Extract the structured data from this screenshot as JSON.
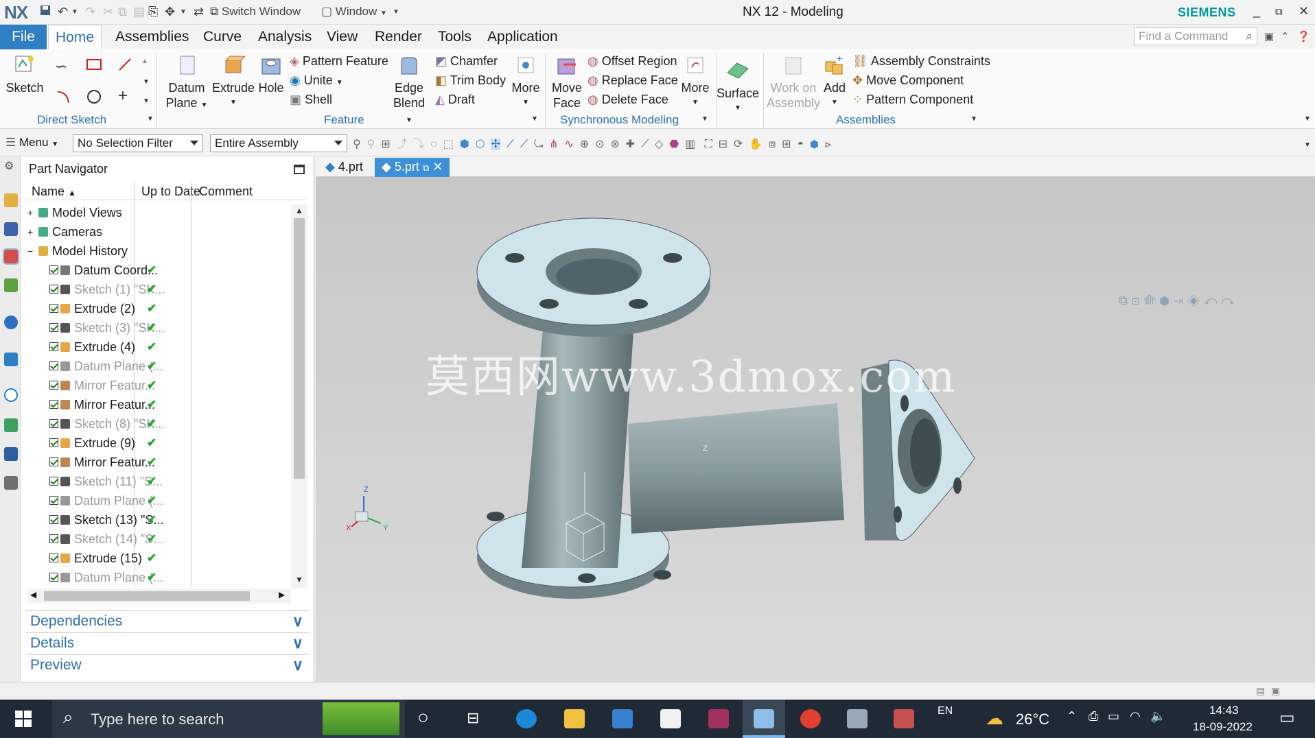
{
  "titlebar": {
    "app_logo": "NX",
    "switch_window": "Switch Window",
    "window_menu": "Window",
    "title": "NX 12 - Modeling",
    "brand": "SIEMENS"
  },
  "menu": {
    "file": "File",
    "tabs": [
      "Home",
      "Assemblies",
      "Curve",
      "Analysis",
      "View",
      "Render",
      "Tools",
      "Application"
    ],
    "active_tab": "Home",
    "find_placeholder": "Find a Command"
  },
  "ribbon": {
    "direct_sketch": {
      "sketch": "Sketch",
      "label": "Direct Sketch"
    },
    "feature": {
      "datum_plane": "Datum Plane",
      "datum_plane_l1": "Datum",
      "datum_plane_l2": "Plane",
      "extrude": "Extrude",
      "hole": "Hole",
      "pattern_feature": "Pattern Feature",
      "unite": "Unite",
      "shell": "Shell",
      "edge_blend_l1": "Edge",
      "edge_blend_l2": "Blend",
      "chamfer": "Chamfer",
      "trim_body": "Trim Body",
      "draft": "Draft",
      "more": "More",
      "label": "Feature"
    },
    "sync": {
      "move_face_l1": "Move",
      "move_face_l2": "Face",
      "offset_region": "Offset Region",
      "replace_face": "Replace Face",
      "delete_face": "Delete Face",
      "more": "More",
      "label": "Synchronous Modeling"
    },
    "surface": {
      "surface": "Surface"
    },
    "assemblies": {
      "work_on_l1": "Work on",
      "work_on_l2": "Assembly",
      "add": "Add",
      "assembly_constraints": "Assembly Constraints",
      "move_component": "Move Component",
      "pattern_component": "Pattern Component",
      "label": "Assemblies"
    }
  },
  "selbar": {
    "menu": "Menu",
    "filter": "No Selection Filter",
    "scope": "Entire Assembly"
  },
  "navigator": {
    "title": "Part Navigator",
    "columns": [
      "Name",
      "Up to Date",
      "Comment"
    ],
    "rows": [
      {
        "name": "Model Views",
        "level": 0,
        "type": "group",
        "dim": false,
        "uptodate": ""
      },
      {
        "name": "Cameras",
        "level": 0,
        "type": "group",
        "dim": false,
        "uptodate": ""
      },
      {
        "name": "Model History",
        "level": 0,
        "type": "folder",
        "dim": false,
        "uptodate": ""
      },
      {
        "name": "Datum Coord...",
        "level": 1,
        "type": "datum",
        "dim": false,
        "uptodate": "✔"
      },
      {
        "name": "Sketch (1) \"SK...",
        "level": 1,
        "type": "sketch",
        "dim": true,
        "uptodate": "✔"
      },
      {
        "name": "Extrude (2)",
        "level": 1,
        "type": "extrude",
        "dim": false,
        "uptodate": "✔"
      },
      {
        "name": "Sketch (3) \"SK...",
        "level": 1,
        "type": "sketch",
        "dim": true,
        "uptodate": "✔"
      },
      {
        "name": "Extrude (4)",
        "level": 1,
        "type": "extrude",
        "dim": false,
        "uptodate": "✔"
      },
      {
        "name": "Datum Plane (...",
        "level": 1,
        "type": "plane",
        "dim": true,
        "uptodate": "✔"
      },
      {
        "name": "Mirror Featur...",
        "level": 1,
        "type": "mirror",
        "dim": true,
        "uptodate": "✔"
      },
      {
        "name": "Mirror Featur...",
        "level": 1,
        "type": "mirror",
        "dim": false,
        "uptodate": "✔"
      },
      {
        "name": "Sketch (8) \"SK...",
        "level": 1,
        "type": "sketch",
        "dim": true,
        "uptodate": "✔"
      },
      {
        "name": "Extrude (9)",
        "level": 1,
        "type": "extrude",
        "dim": false,
        "uptodate": "✔"
      },
      {
        "name": "Mirror Featur...",
        "level": 1,
        "type": "mirror",
        "dim": false,
        "uptodate": "✔"
      },
      {
        "name": "Sketch (11) \"S...",
        "level": 1,
        "type": "sketch",
        "dim": true,
        "uptodate": "✔"
      },
      {
        "name": "Datum Plane (...",
        "level": 1,
        "type": "plane",
        "dim": true,
        "uptodate": "✔"
      },
      {
        "name": "Sketch (13) \"S...",
        "level": 1,
        "type": "sketch",
        "dim": false,
        "uptodate": "✔"
      },
      {
        "name": "Sketch (14) \"S...",
        "level": 1,
        "type": "sketch",
        "dim": true,
        "uptodate": "✔"
      },
      {
        "name": "Extrude (15)",
        "level": 1,
        "type": "extrude",
        "dim": false,
        "uptodate": "✔"
      },
      {
        "name": "Datum Plane (...",
        "level": 1,
        "type": "plane",
        "dim": true,
        "uptodate": "✔"
      }
    ],
    "panels": [
      "Dependencies",
      "Details",
      "Preview"
    ]
  },
  "doc_tabs": [
    "4.prt",
    "5.prt"
  ],
  "active_doc": "5.prt",
  "watermark": "莫西网www.3dmox.com",
  "triad": {
    "z": "Z",
    "x": "X",
    "y": "Y"
  },
  "taskbar": {
    "search_placeholder": "Type here to search",
    "lang": "EN",
    "weather": "26°C",
    "time": "14:43",
    "date": "18-09-2022"
  },
  "colors": {
    "accent": "#2f7fc4",
    "brand": "#009999",
    "part_face": "#cfe4ea",
    "part_side": "#7f9196"
  }
}
